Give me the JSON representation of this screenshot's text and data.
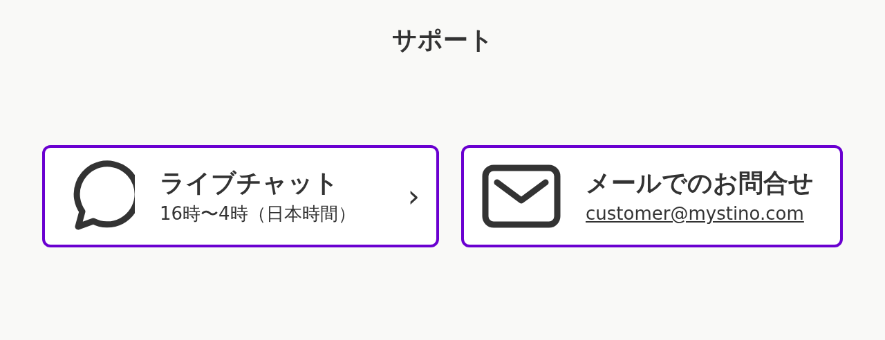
{
  "title": "サポート",
  "cards": [
    {
      "kind": "chat",
      "title": "ライブチャット",
      "subtitle": "16時〜4時（日本時間）",
      "chevron": "›"
    },
    {
      "kind": "mail",
      "title": "メールでのお問合せ",
      "link": "customer@mystino.com"
    }
  ]
}
